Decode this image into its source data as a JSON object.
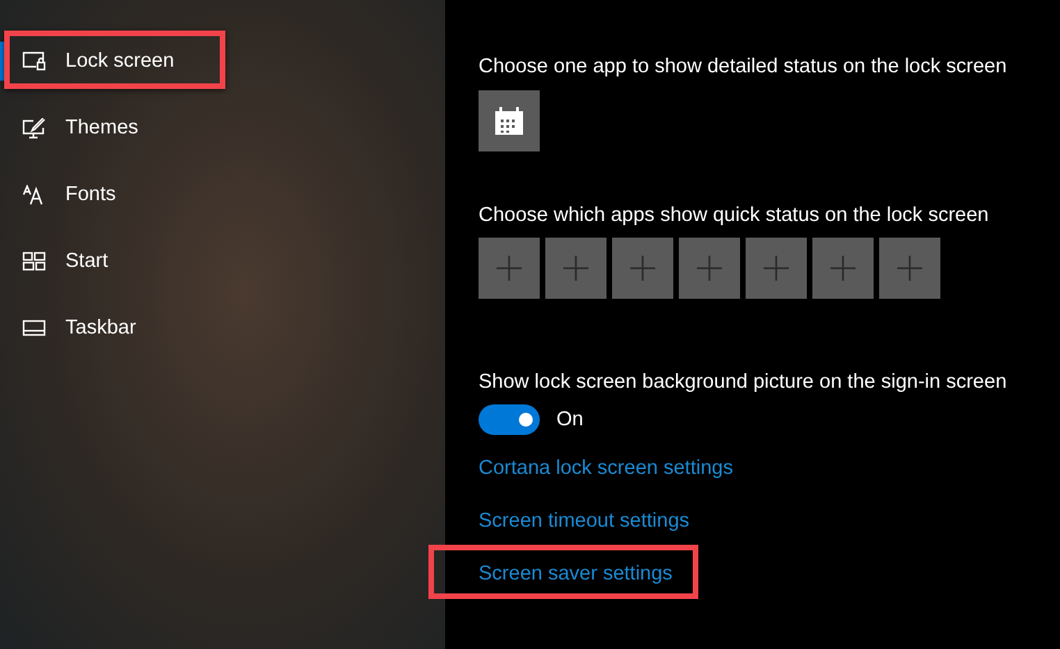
{
  "nav": {
    "items": [
      {
        "label": "Lock screen",
        "kind": "lock-screen",
        "selected": true,
        "highlighted": true
      },
      {
        "label": "Themes",
        "kind": "themes",
        "selected": false,
        "highlighted": false
      },
      {
        "label": "Fonts",
        "kind": "fonts",
        "selected": false,
        "highlighted": false
      },
      {
        "label": "Start",
        "kind": "start",
        "selected": false,
        "highlighted": false
      },
      {
        "label": "Taskbar",
        "kind": "taskbar",
        "selected": false,
        "highlighted": false
      }
    ]
  },
  "panel": {
    "detailed_status": {
      "heading": "Choose one app to show detailed status on the lock screen",
      "slot": {
        "kind": "calendar"
      }
    },
    "quick_status": {
      "heading": "Choose which apps show quick status on the lock screen",
      "slots": [
        {
          "kind": "empty"
        },
        {
          "kind": "empty"
        },
        {
          "kind": "empty"
        },
        {
          "kind": "empty"
        },
        {
          "kind": "empty"
        },
        {
          "kind": "empty"
        },
        {
          "kind": "empty"
        }
      ]
    },
    "background_toggle": {
      "heading": "Show lock screen background picture on the sign-in screen",
      "on": true,
      "state_label": "On"
    },
    "links": [
      {
        "label": "Cortana lock screen settings",
        "highlighted": false
      },
      {
        "label": "Screen timeout settings",
        "highlighted": false
      },
      {
        "label": "Screen saver settings",
        "highlighted": true
      }
    ]
  }
}
